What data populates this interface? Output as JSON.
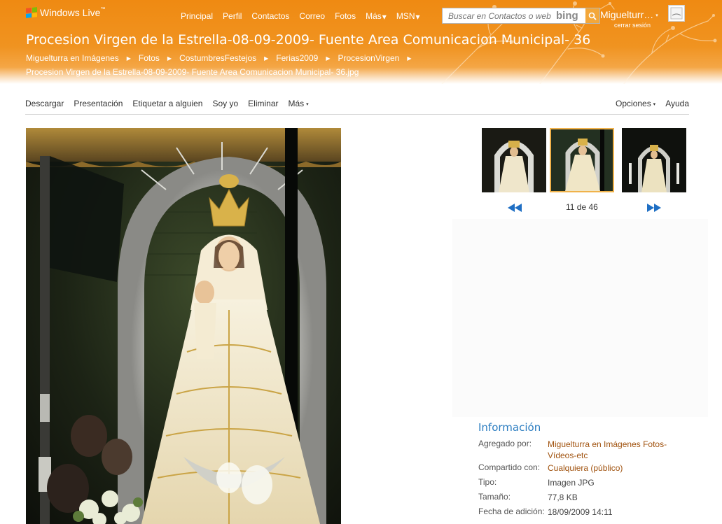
{
  "header": {
    "brand": "Windows Live",
    "brand_tm": "™",
    "nav": [
      "Principal",
      "Perfil",
      "Contactos",
      "Correo",
      "Fotos",
      "Más",
      "MSN"
    ],
    "search_placeholder": "Buscar en Contactos o web",
    "search_engine": "bing",
    "user_name": "Miguelturr…",
    "sign_out": "cerrar sesión"
  },
  "page": {
    "title": "Procesion Virgen de la Estrella-08-09-2009- Fuente Area Comunicacion Municipal- 36",
    "breadcrumbs": [
      "Miguelturra en Imágenes",
      "Fotos",
      "CostumbresFestejos",
      "Ferias2009",
      "ProcesionVirgen"
    ],
    "filename": "Procesion Virgen de la Estrella-08-09-2009- Fuente Area Comunicacion Municipal- 36.jpg"
  },
  "toolbar": {
    "left": [
      "Descargar",
      "Presentación",
      "Etiquetar a alguien",
      "Soy yo",
      "Eliminar",
      "Más"
    ],
    "options": "Opciones",
    "help": "Ayuda"
  },
  "viewer": {
    "counter": "11 de 46",
    "selected_thumb": 1,
    "accent_color": "#f0b24b"
  },
  "info": {
    "title": "Información",
    "rows": [
      {
        "label": "Agregado por:",
        "value": "Miguelturra en Imágenes Fotos-Vídeos-etc",
        "link": true
      },
      {
        "label": "Compartido con:",
        "value": "Cualquiera (público)",
        "link": true
      },
      {
        "label": "Tipo:",
        "value": "Imagen JPG",
        "link": false
      },
      {
        "label": "Tamaño:",
        "value": "77,8 KB",
        "link": false
      },
      {
        "label": "Fecha de adición:",
        "value": "18/09/2009 14:11",
        "link": false
      }
    ]
  },
  "colors": {
    "header_orange": "#ef8a12",
    "link_brown": "#a0520e",
    "info_blue": "#2a7cc0"
  }
}
